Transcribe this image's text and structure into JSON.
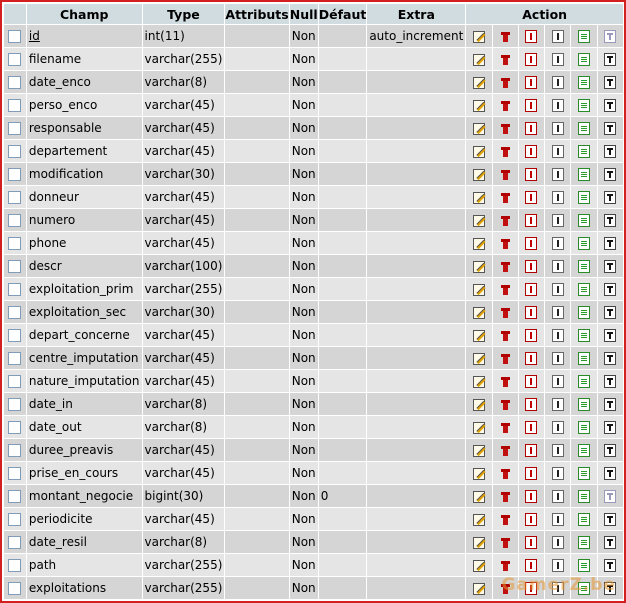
{
  "header": {
    "champ": "Champ",
    "type": "Type",
    "attributs": "Attributs",
    "null": "Null",
    "defaut": "Défaut",
    "extra": "Extra",
    "action": "Action"
  },
  "icons": [
    "edit-icon",
    "drop-icon",
    "primary-key-icon",
    "index-icon",
    "unique-icon",
    "fulltext-icon"
  ],
  "colors": {
    "header_bg": "#d0dce0",
    "row_odd": "#d5d5d5",
    "row_even": "#e5e5e5",
    "border": "#d21f1f"
  },
  "rows": [
    {
      "champ": "id",
      "type": "int(11)",
      "attributs": "",
      "null": "Non",
      "defaut": "",
      "extra": "auto_increment",
      "fulltext": false
    },
    {
      "champ": "filename",
      "type": "varchar(255)",
      "attributs": "",
      "null": "Non",
      "defaut": "",
      "extra": "",
      "fulltext": true
    },
    {
      "champ": "date_enco",
      "type": "varchar(8)",
      "attributs": "",
      "null": "Non",
      "defaut": "",
      "extra": "",
      "fulltext": true
    },
    {
      "champ": "perso_enco",
      "type": "varchar(45)",
      "attributs": "",
      "null": "Non",
      "defaut": "",
      "extra": "",
      "fulltext": true
    },
    {
      "champ": "responsable",
      "type": "varchar(45)",
      "attributs": "",
      "null": "Non",
      "defaut": "",
      "extra": "",
      "fulltext": true
    },
    {
      "champ": "departement",
      "type": "varchar(45)",
      "attributs": "",
      "null": "Non",
      "defaut": "",
      "extra": "",
      "fulltext": true
    },
    {
      "champ": "modification",
      "type": "varchar(30)",
      "attributs": "",
      "null": "Non",
      "defaut": "",
      "extra": "",
      "fulltext": true
    },
    {
      "champ": "donneur",
      "type": "varchar(45)",
      "attributs": "",
      "null": "Non",
      "defaut": "",
      "extra": "",
      "fulltext": true
    },
    {
      "champ": "numero",
      "type": "varchar(45)",
      "attributs": "",
      "null": "Non",
      "defaut": "",
      "extra": "",
      "fulltext": true
    },
    {
      "champ": "phone",
      "type": "varchar(45)",
      "attributs": "",
      "null": "Non",
      "defaut": "",
      "extra": "",
      "fulltext": true
    },
    {
      "champ": "descr",
      "type": "varchar(100)",
      "attributs": "",
      "null": "Non",
      "defaut": "",
      "extra": "",
      "fulltext": true
    },
    {
      "champ": "exploitation_prim",
      "type": "varchar(255)",
      "attributs": "",
      "null": "Non",
      "defaut": "",
      "extra": "",
      "fulltext": true
    },
    {
      "champ": "exploitation_sec",
      "type": "varchar(30)",
      "attributs": "",
      "null": "Non",
      "defaut": "",
      "extra": "",
      "fulltext": true
    },
    {
      "champ": "depart_concerne",
      "type": "varchar(45)",
      "attributs": "",
      "null": "Non",
      "defaut": "",
      "extra": "",
      "fulltext": true
    },
    {
      "champ": "centre_imputation",
      "type": "varchar(45)",
      "attributs": "",
      "null": "Non",
      "defaut": "",
      "extra": "",
      "fulltext": true
    },
    {
      "champ": "nature_imputation",
      "type": "varchar(45)",
      "attributs": "",
      "null": "Non",
      "defaut": "",
      "extra": "",
      "fulltext": true
    },
    {
      "champ": "date_in",
      "type": "varchar(8)",
      "attributs": "",
      "null": "Non",
      "defaut": "",
      "extra": "",
      "fulltext": true
    },
    {
      "champ": "date_out",
      "type": "varchar(8)",
      "attributs": "",
      "null": "Non",
      "defaut": "",
      "extra": "",
      "fulltext": true
    },
    {
      "champ": "duree_preavis",
      "type": "varchar(45)",
      "attributs": "",
      "null": "Non",
      "defaut": "",
      "extra": "",
      "fulltext": true
    },
    {
      "champ": "prise_en_cours",
      "type": "varchar(45)",
      "attributs": "",
      "null": "Non",
      "defaut": "",
      "extra": "",
      "fulltext": true
    },
    {
      "champ": "montant_negocie",
      "type": "bigint(30)",
      "attributs": "",
      "null": "Non",
      "defaut": "0",
      "extra": "",
      "fulltext": false
    },
    {
      "champ": "periodicite",
      "type": "varchar(45)",
      "attributs": "",
      "null": "Non",
      "defaut": "",
      "extra": "",
      "fulltext": true
    },
    {
      "champ": "date_resil",
      "type": "varchar(8)",
      "attributs": "",
      "null": "Non",
      "defaut": "",
      "extra": "",
      "fulltext": true
    },
    {
      "champ": "path",
      "type": "varchar(255)",
      "attributs": "",
      "null": "Non",
      "defaut": "",
      "extra": "",
      "fulltext": true
    },
    {
      "champ": "exploitations",
      "type": "varchar(255)",
      "attributs": "",
      "null": "Non",
      "defaut": "",
      "extra": "",
      "fulltext": true
    }
  ],
  "watermark": "GamerZ.be"
}
